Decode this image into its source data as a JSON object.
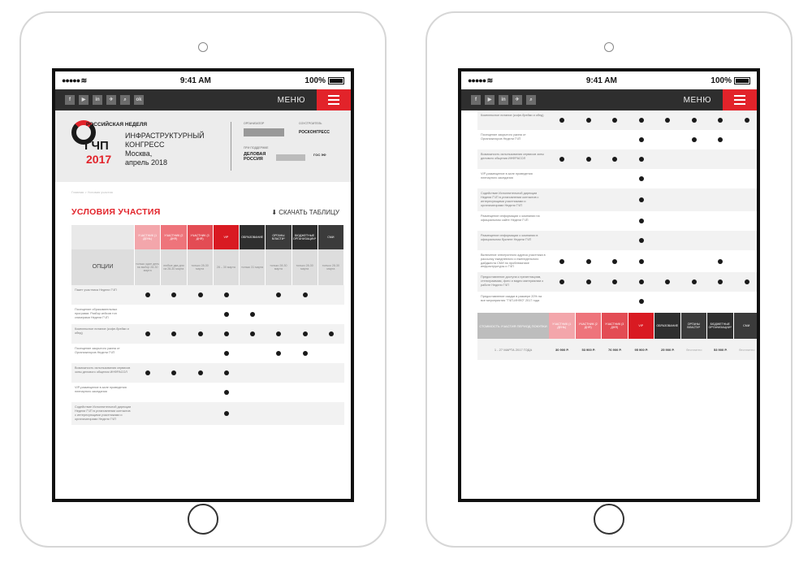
{
  "status": {
    "time": "9:41 AM",
    "battery": "100%",
    "signal": "●●●●● ≋"
  },
  "nav": {
    "menu_label": "МЕНЮ",
    "social": [
      "f",
      "▶",
      "in",
      "✈",
      "⌕",
      "ok"
    ]
  },
  "header": {
    "logo_top": "РОССИЙСКАЯ НЕДЕЛЯ",
    "logo_big": "ГЧП",
    "logo_year": "2017",
    "congress_l1": "ИНФРАСТРУКТУРНЫЙ",
    "congress_l2": "КОНГРЕСС",
    "congress_l3": "Москва,",
    "congress_l4": "апрель 2018",
    "organizer_label": "ОРГАНИЗАТОР",
    "cooperator_label": "СОУСТРОИТЕЛЬ",
    "support_label": "ПРИ ПОДДЕРЖКЕ",
    "roscongress": "РОСКОНГРЕСС",
    "delovaya": "ДЕЛОВАЯ РОССИЯ",
    "gosuslugi": "ГОС ЭФ"
  },
  "breadcrumb": "Главная > Условия участия",
  "page": {
    "title": "УСЛОВИЯ УЧАСТИЯ",
    "download": "⬇ СКАЧАТЬ ТАБЛИЦУ"
  },
  "table": {
    "options_label": "ОПЦИИ",
    "columns": [
      {
        "name": "УЧАСТНИК (1 ДЕНЬ)",
        "sub": "только один день на выбор 28-30 марта",
        "color": "#f3a6ab"
      },
      {
        "name": "УЧАСТНИК (2 ДНЯ)",
        "sub": "любые два дня из 28-30 марта",
        "color": "#ee747b"
      },
      {
        "name": "УЧАСТНИК (3 ДНЯ)",
        "sub": "только 28-30 марта",
        "color": "#e34c54"
      },
      {
        "name": "VIP",
        "sub": "28 – 30 марта",
        "color": "#d91a22"
      },
      {
        "name": "ОБРАЗОВАНИЕ",
        "sub": "только 31 марта",
        "color": "#2f2f2f"
      },
      {
        "name": "ОРГАНЫ ВЛАСТИ*",
        "sub": "только 28-30 марта",
        "color": "#3b3b3b"
      },
      {
        "name": "БЮДЖЕТНЫЕ ОРГАНИЗАЦИИ*",
        "sub": "только 28-30 марта",
        "color": "#2f2f2f"
      },
      {
        "name": "СМИ",
        "sub": "только 28-30 марта",
        "color": "#3b3b3b"
      }
    ],
    "rows_left": [
      {
        "label": "Пакет участника Недели ГЧП",
        "dots": [
          1,
          1,
          1,
          1,
          0,
          1,
          1,
          0
        ]
      },
      {
        "label": "Посещение образовательных программ. Разбор кейсов топ спикерами Недели ГЧП",
        "dots": [
          0,
          0,
          0,
          1,
          1,
          0,
          0,
          0
        ]
      },
      {
        "label": "Комплексное питание (кофе-брейки и обед)",
        "dots": [
          1,
          1,
          1,
          1,
          1,
          1,
          1,
          1
        ]
      },
      {
        "label": "Посещение закрытого ужина от Организаторов Недели ГЧП",
        "dots": [
          0,
          0,
          0,
          1,
          0,
          1,
          1,
          0
        ]
      },
      {
        "label": "Возможность использования сервисов зоны делового общения ИНФРАСОЛ",
        "dots": [
          1,
          1,
          1,
          1,
          0,
          0,
          0,
          0
        ]
      },
      {
        "label": "VIP-размещение в зале проведения пленарного заседания",
        "dots": [
          0,
          0,
          0,
          1,
          0,
          0,
          0,
          0
        ]
      },
      {
        "label": "Содействие Исполнительной дирекции Недели ГЧП в установлении контактов с интересующими участниками и организаторами Недели ГЧП",
        "dots": [
          0,
          0,
          0,
          1,
          0,
          0,
          0,
          0
        ]
      }
    ],
    "rows_right": [
      {
        "label": "Комплексное питание (кофе-брейки и обед)",
        "dots": [
          1,
          1,
          1,
          1,
          1,
          1,
          1,
          1
        ]
      },
      {
        "label": "Посещение закрытого ужина от Организаторов Недели ГЧП",
        "dots": [
          0,
          0,
          0,
          1,
          0,
          1,
          1,
          0
        ]
      },
      {
        "label": "Возможность использования сервисов зоны делового общения ИНФРАСОЛ",
        "dots": [
          1,
          1,
          1,
          1,
          0,
          0,
          0,
          0
        ]
      },
      {
        "label": "VIP-размещение в зале проведения пленарного заседания",
        "dots": [
          0,
          0,
          0,
          1,
          0,
          0,
          0,
          0
        ]
      },
      {
        "label": "Содействие Исполнительной дирекции Недели ГЧП в установлении контактов с интересующими участниками и организаторами Недели ГЧП",
        "dots": [
          0,
          0,
          0,
          1,
          0,
          0,
          0,
          0
        ]
      },
      {
        "label": "Размещение информации о компании на официальном сайте Недели ГЧП",
        "dots": [
          0,
          0,
          0,
          1,
          0,
          0,
          0,
          0
        ]
      },
      {
        "label": "Размещение информации о компании в официальном буклете Недели ГЧП",
        "dots": [
          0,
          0,
          0,
          1,
          0,
          0,
          0,
          0
        ]
      },
      {
        "label": "Включение электронного адреса участника в рассылку ежедневного и еженедельного дайджеста СМИ по проблематике инфраструктуры и ГЧП",
        "dots": [
          1,
          1,
          1,
          1,
          0,
          0,
          1,
          0
        ]
      },
      {
        "label": "Предоставление доступа к презентациям, стенограммам, фото и видео материалам о работе Недели ГЧП",
        "dots": [
          1,
          1,
          1,
          1,
          1,
          1,
          1,
          1
        ]
      },
      {
        "label": "Предоставление скидки в размере 20% на все мероприятия \"ГЧП-ИНФО\" 2017 года",
        "dots": [
          0,
          0,
          0,
          1,
          0,
          0,
          0,
          0
        ]
      }
    ],
    "cost_label": "СТОИМОСТЬ УЧАСТИЯ ПЕРИОД ПОКУПКИ",
    "cost_row": {
      "period": "1 - 27 МАРТА 2017 ГОДА",
      "prices": [
        "30 900 Р.",
        "53 900 Р.",
        "76 900 Р.",
        "95 900 Р.",
        "25 900 Р.",
        "бесплатно",
        "53 900 Р.",
        "бесплатно"
      ]
    }
  }
}
